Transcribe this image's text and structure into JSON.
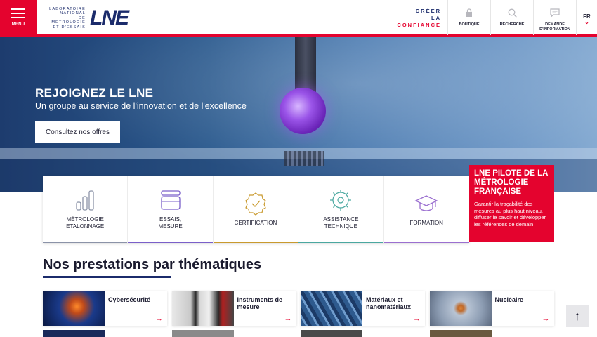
{
  "header": {
    "menu_label": "MENU",
    "logo_lines": [
      "LABORATOIRE",
      "NATIONAL",
      "DE MÉTROLOGIE",
      "ET D'ESSAIS"
    ],
    "logo_mark": "LNE",
    "tagline": [
      "CRÉER",
      "LA",
      "CONFIANCE"
    ],
    "buttons": [
      {
        "label": "BOUTIQUE",
        "icon": "lock-icon"
      },
      {
        "label": "RECHERCHE",
        "icon": "search-icon"
      },
      {
        "label_line1": "DEMANDE",
        "label_line2": "D'INFORMATION",
        "icon": "message-icon"
      }
    ],
    "lang": "FR"
  },
  "hero": {
    "title": "REJOIGNEZ LE LNE",
    "subtitle": "Un groupe au service de l'innovation et de l'excellence",
    "cta": "Consultez nos offres"
  },
  "services": [
    {
      "line1": "Métrologie",
      "line2": "Etalonnage",
      "color": "#8b93a8"
    },
    {
      "line1": "Essais,",
      "line2": "mesure",
      "color": "#7a5fc9"
    },
    {
      "line1": "Certification",
      "line2": "",
      "color": "#c99a2e"
    },
    {
      "line1": "Assistance",
      "line2": "technique",
      "color": "#4aa8a0"
    },
    {
      "line1": "Formation",
      "line2": "",
      "color": "#9b6fd0"
    }
  ],
  "promo": {
    "title": "LNE PILOTE DE LA MÉTROLOGIE FRANÇAISE",
    "desc": "Garantir la traçabilité des mesures au plus haut niveau, diffuser le savoir et développer les références de demain"
  },
  "section": {
    "title": "Nos prestations par thématiques",
    "tiles": [
      {
        "label": "Cybersécurité"
      },
      {
        "label": "Instruments de mesure"
      },
      {
        "label": "Matériaux et nanomatériaux"
      },
      {
        "label": "Nucléaire"
      }
    ]
  },
  "colors": {
    "accent": "#e4032e",
    "brand": "#1b2b6b"
  }
}
